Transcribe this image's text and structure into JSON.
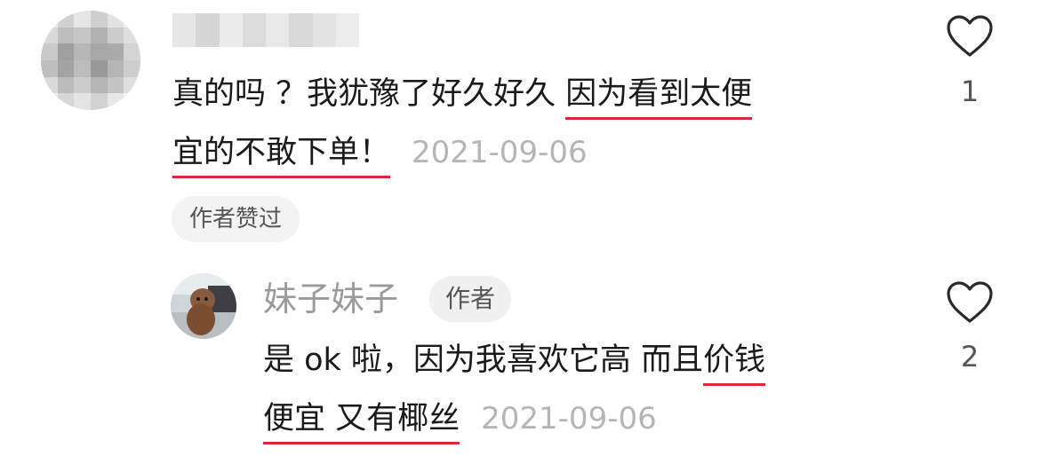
{
  "comment": {
    "username_blurred": true,
    "text_line1_plain": "真的吗 ？我犹豫了好久好久 ",
    "text_line1_underlined": "因为看到太便",
    "text_line2_underlined": "宜的不敢下单！",
    "date": "2021-09-06",
    "liked_by_author_badge": "作者赞过",
    "like_count": "1"
  },
  "reply": {
    "username": "妹子妹子",
    "author_tag": "作者",
    "text_line1_plain": "是 ok 啦，因为我喜欢它高  而且",
    "text_line1_underlined": "价钱",
    "text_line2_underlined": "便宜 又有椰丝",
    "date": "2021-09-06",
    "like_count": "2"
  },
  "colors": {
    "underline": "#d62b35",
    "date_text": "#b5b5b5",
    "badge_bg": "#f3f3f3",
    "heart_outline": "#2a2a2a"
  }
}
